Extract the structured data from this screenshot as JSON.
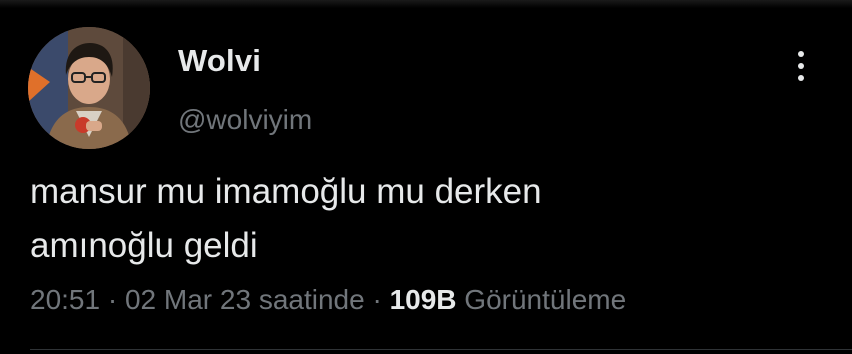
{
  "tweet": {
    "author": {
      "display_name": "Wolvi",
      "handle": "@wolviyim",
      "avatar_icon": "user-avatar"
    },
    "more_icon": "more-vertical-icon",
    "text_lines": [
      "mansur mu imamoğlu mu derken",
      "amınoğlu geldi"
    ],
    "meta": {
      "time": "20:51",
      "separator": "·",
      "date": "02 Mar 23 saatinde",
      "views_count": "109B",
      "views_label": "Görüntüleme"
    }
  },
  "colors": {
    "background": "#000000",
    "primary_text": "#e7e9ea",
    "secondary_text": "#71767b",
    "divider": "#2f3336"
  }
}
